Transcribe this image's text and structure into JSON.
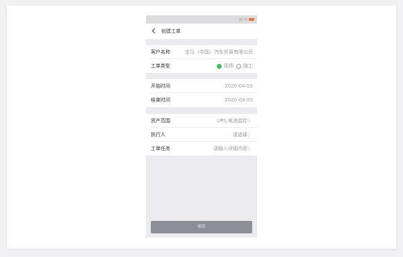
{
  "nav": {
    "title": "创建工单"
  },
  "form": {
    "customer": {
      "label": "客户名称",
      "value": "宝马（中国）汽车贸易有限公司"
    },
    "type": {
      "label": "工单类型",
      "options": [
        {
          "label": "现场",
          "selected": true
        },
        {
          "label": "随工",
          "selected": false
        }
      ]
    },
    "start": {
      "label": "开始时间",
      "value": "2020-04-03"
    },
    "end": {
      "label": "结束时间",
      "value": "2020-04-03"
    },
    "assets": {
      "label": "资产范围",
      "value": "UPS,电池监控"
    },
    "executor": {
      "label": "执行人",
      "value": "请选择"
    },
    "task": {
      "label": "工单任务",
      "value": "请输入详细内容"
    }
  },
  "actions": {
    "save_label": "保存"
  },
  "colors": {
    "accent": "#3cc05a",
    "button": "#8e8e98",
    "battery": "#e07a3c"
  },
  "icons": {
    "back": "chevron-left-icon",
    "chevron": "chevron-right-icon"
  }
}
